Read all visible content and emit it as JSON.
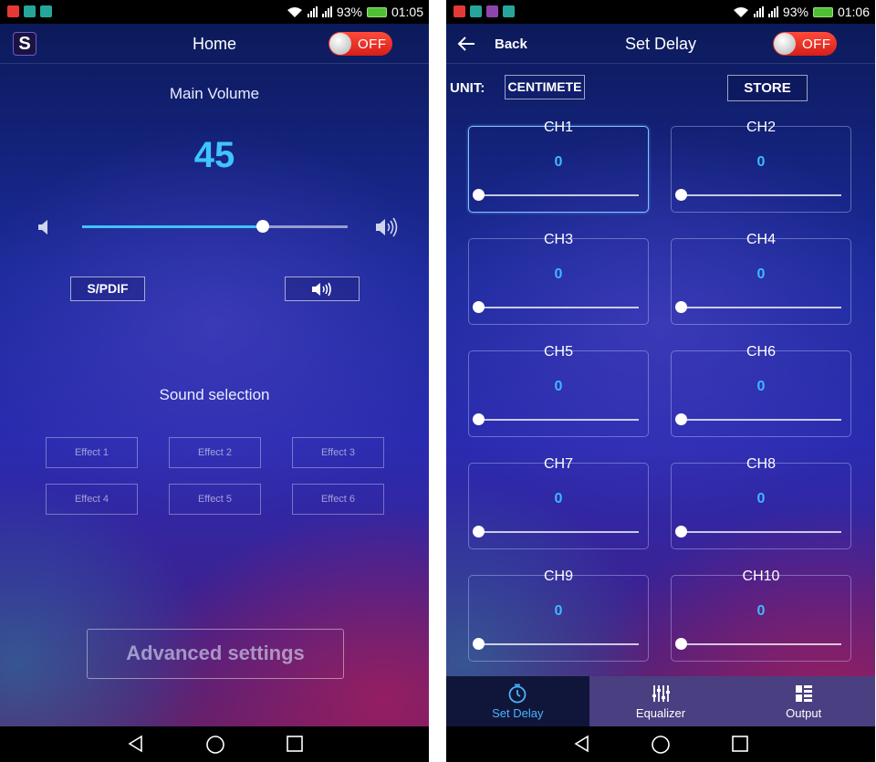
{
  "status_left": {
    "time": "01:05",
    "battery": "93%"
  },
  "status_right": {
    "time": "01:06",
    "battery": "93%"
  },
  "home": {
    "title": "Home",
    "power_toggle": "OFF",
    "main_volume_label": "Main Volume",
    "volume": 45,
    "volume_fraction": 0.68,
    "spdif_label": "S/PDIF",
    "sound_selection_label": "Sound selection",
    "effects": [
      "Effect 1",
      "Effect 2",
      "Effect 3",
      "Effect 4",
      "Effect 5",
      "Effect 6"
    ],
    "advanced_label": "Advanced settings"
  },
  "delay": {
    "back_label": "Back",
    "title": "Set Delay",
    "power_toggle": "OFF",
    "unit_label": "UNIT:",
    "unit_value": "CENTIMETER",
    "store_label": "STORE",
    "channels": [
      {
        "name": "CH1",
        "value": "0"
      },
      {
        "name": "CH2",
        "value": "0"
      },
      {
        "name": "CH3",
        "value": "0"
      },
      {
        "name": "CH4",
        "value": "0"
      },
      {
        "name": "CH5",
        "value": "0"
      },
      {
        "name": "CH6",
        "value": "0"
      },
      {
        "name": "CH7",
        "value": "0"
      },
      {
        "name": "CH8",
        "value": "0"
      },
      {
        "name": "CH9",
        "value": "0"
      },
      {
        "name": "CH10",
        "value": "0"
      }
    ],
    "tabs": [
      {
        "label": "Set Delay",
        "icon": "timer-icon",
        "active": true
      },
      {
        "label": "Equalizer",
        "icon": "equalizer-sliders-icon",
        "active": false
      },
      {
        "label": "Output",
        "icon": "output-grid-icon",
        "active": false
      }
    ]
  },
  "colors": {
    "accent": "#3fb8ff",
    "toggle_off": "#e02a20",
    "tab_active": "#4ab3ff"
  }
}
